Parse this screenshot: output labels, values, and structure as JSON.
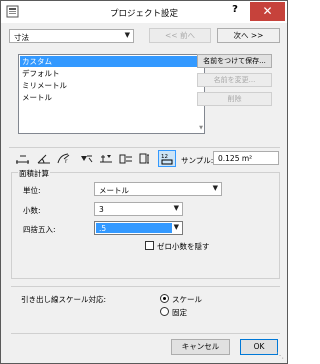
{
  "window": {
    "title": "プロジェクト設定",
    "help": "?",
    "close": "✕"
  },
  "topbar": {
    "category": "寸法",
    "prev": "<< 前へ",
    "next": "次へ >>"
  },
  "styles": {
    "items": [
      "カスタム",
      "デフォルト",
      "ミリメートル",
      "メートル"
    ],
    "selected_index": 0,
    "save_as": "名前をつけて保存...",
    "rename": "名前を変更...",
    "delete": "削除"
  },
  "toolbar": {
    "icons": [
      "linear-dimension-icon",
      "angle-dimension-icon",
      "radial-dimension-icon",
      "level-dimension-icon",
      "elevation-dimension-icon",
      "door-window-dimension-icon",
      "sill-height-icon",
      "area-calculation-icon"
    ],
    "selected_index": 7,
    "sample_label": "サンプル:",
    "sample_value": "0.125 m²"
  },
  "area_calc": {
    "group_label": "面積計算",
    "unit_label": "単位:",
    "unit_value": "メートル",
    "decimals_label": "小数:",
    "decimals_value": "3",
    "rounding_label": "四捨五入:",
    "rounding_value": ".5",
    "hide_zero_decimals": "ゼロ小数を隠す",
    "hide_zero_checked": false
  },
  "leader": {
    "label": "引き出し線スケール対応:",
    "options": [
      "スケール",
      "固定"
    ],
    "selected_index": 0
  },
  "footer": {
    "cancel": "キャンセル",
    "ok": "OK"
  }
}
